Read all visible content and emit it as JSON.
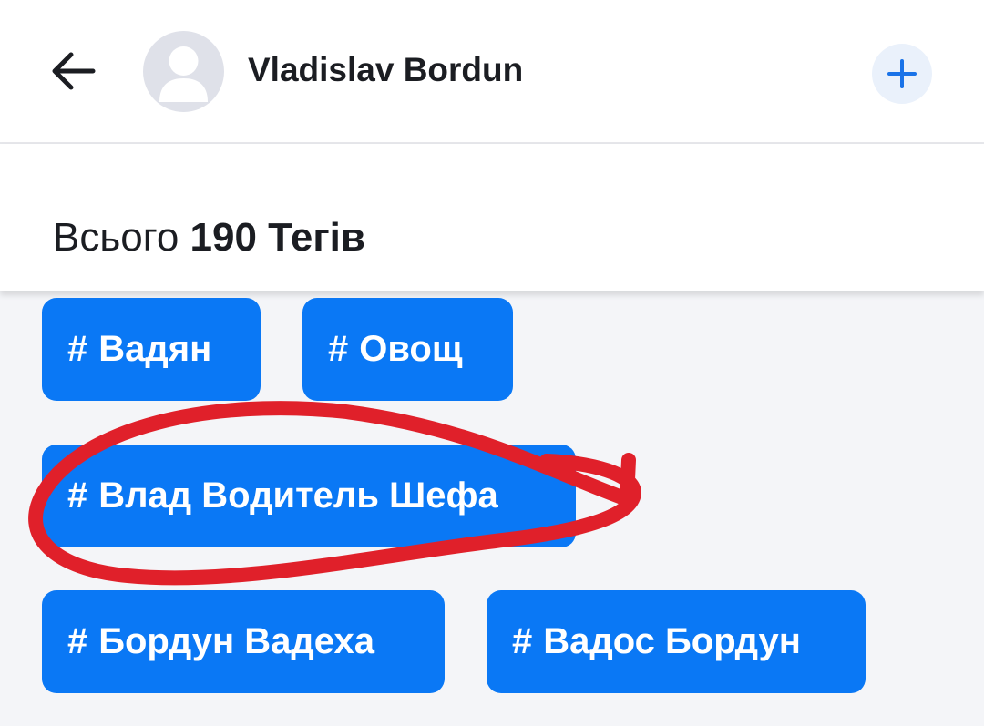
{
  "header": {
    "contact_name": "Vladislav Bordun"
  },
  "summary": {
    "prefix": "Всього",
    "count_text": "190 Тегів"
  },
  "tags": {
    "hash_symbol": "#",
    "items": [
      "Вадян",
      "Овощ",
      "Влад Водитель Шефа",
      "Бордун Вадеха",
      "Вадос Бордун"
    ]
  },
  "icons": {
    "back": "arrow-left-icon",
    "avatar": "user-placeholder-icon",
    "add": "plus-icon"
  },
  "colors": {
    "tag_background": "#0a78f5",
    "tag_text": "#ffffff",
    "accent": "#1a73e8",
    "annotation": "#e0202a"
  }
}
